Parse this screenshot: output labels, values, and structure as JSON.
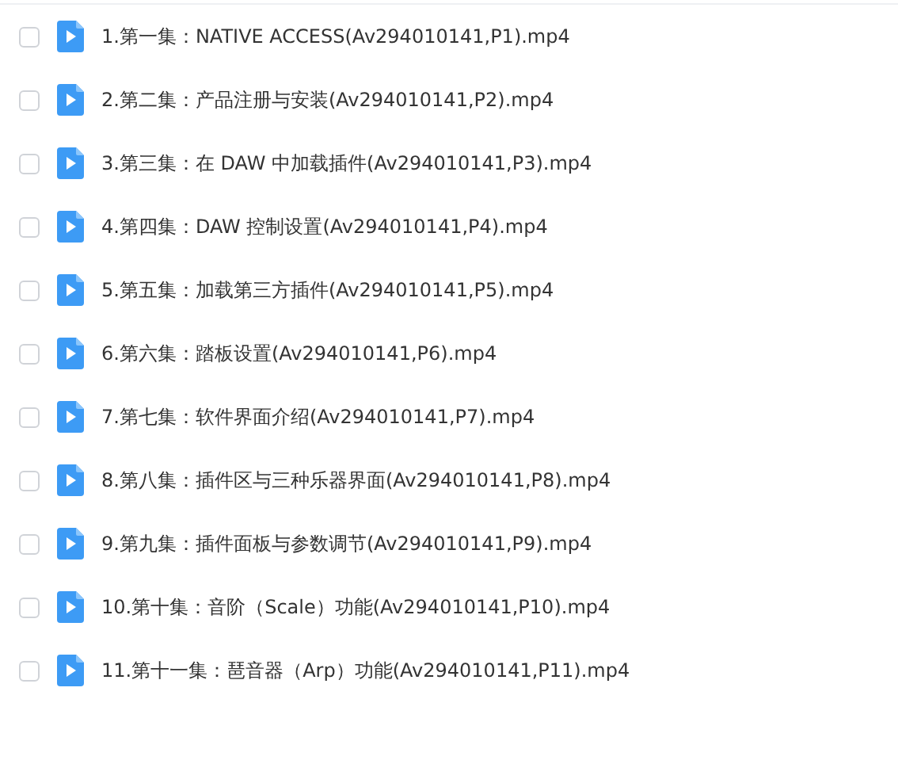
{
  "files": [
    {
      "name": "1.第一集：NATIVE ACCESS(Av294010141,P1).mp4",
      "checked": false
    },
    {
      "name": "2.第二集：产品注册与安装(Av294010141,P2).mp4",
      "checked": false
    },
    {
      "name": "3.第三集：在 DAW 中加载插件(Av294010141,P3).mp4",
      "checked": false
    },
    {
      "name": "4.第四集：DAW 控制设置(Av294010141,P4).mp4",
      "checked": false
    },
    {
      "name": "5.第五集：加载第三方插件(Av294010141,P5).mp4",
      "checked": false
    },
    {
      "name": "6.第六集：踏板设置(Av294010141,P6).mp4",
      "checked": false
    },
    {
      "name": "7.第七集：软件界面介绍(Av294010141,P7).mp4",
      "checked": false
    },
    {
      "name": "8.第八集：插件区与三种乐器界面(Av294010141,P8).mp4",
      "checked": false
    },
    {
      "name": "9.第九集：插件面板与参数调节(Av294010141,P9).mp4",
      "checked": false
    },
    {
      "name": "10.第十集：音阶（Scale）功能(Av294010141,P10).mp4",
      "checked": false
    },
    {
      "name": "11.第十一集：琶音器（Arp）功能(Av294010141,P11).mp4",
      "checked": false
    }
  ]
}
